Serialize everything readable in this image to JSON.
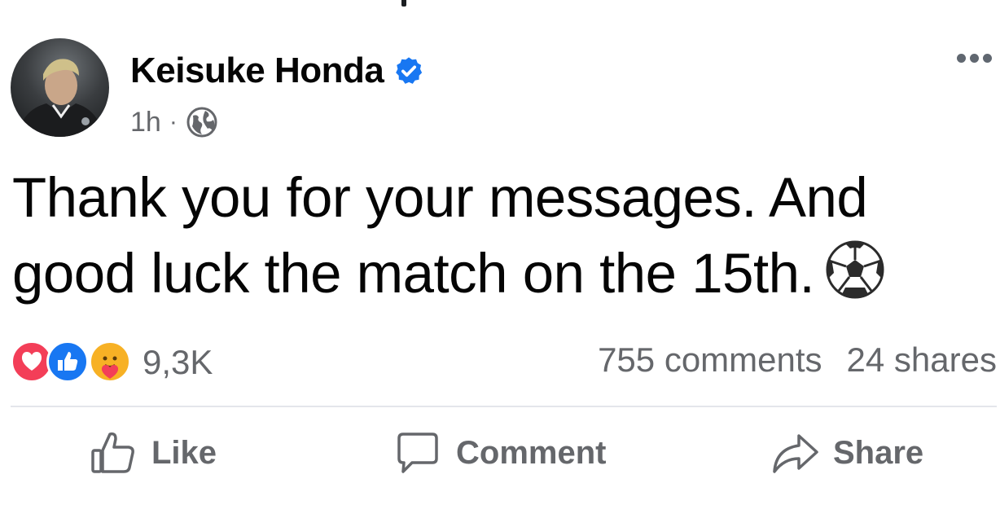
{
  "post": {
    "author_name": "Keisuke Honda",
    "verified_icon": "verified-badge-icon",
    "time": "1h",
    "separator": "·",
    "audience_icon": "globe-icon",
    "more_icon": "more-options-icon",
    "text": "Thank you for your messages. And good luck the match on the 15th.",
    "emoji": "soccer-ball-icon"
  },
  "stats": {
    "reactions": [
      "love-reaction-icon",
      "like-reaction-icon",
      "care-reaction-icon"
    ],
    "reaction_count": "9,3K",
    "comments": "755 comments",
    "shares": "24 shares"
  },
  "actions": {
    "like_label": "Like",
    "comment_label": "Comment",
    "share_label": "Share"
  },
  "colors": {
    "brand_blue": "#1877f2",
    "secondary_text": "#65676b",
    "love_red": "#f33e58",
    "care_yellow": "#f7b125"
  }
}
